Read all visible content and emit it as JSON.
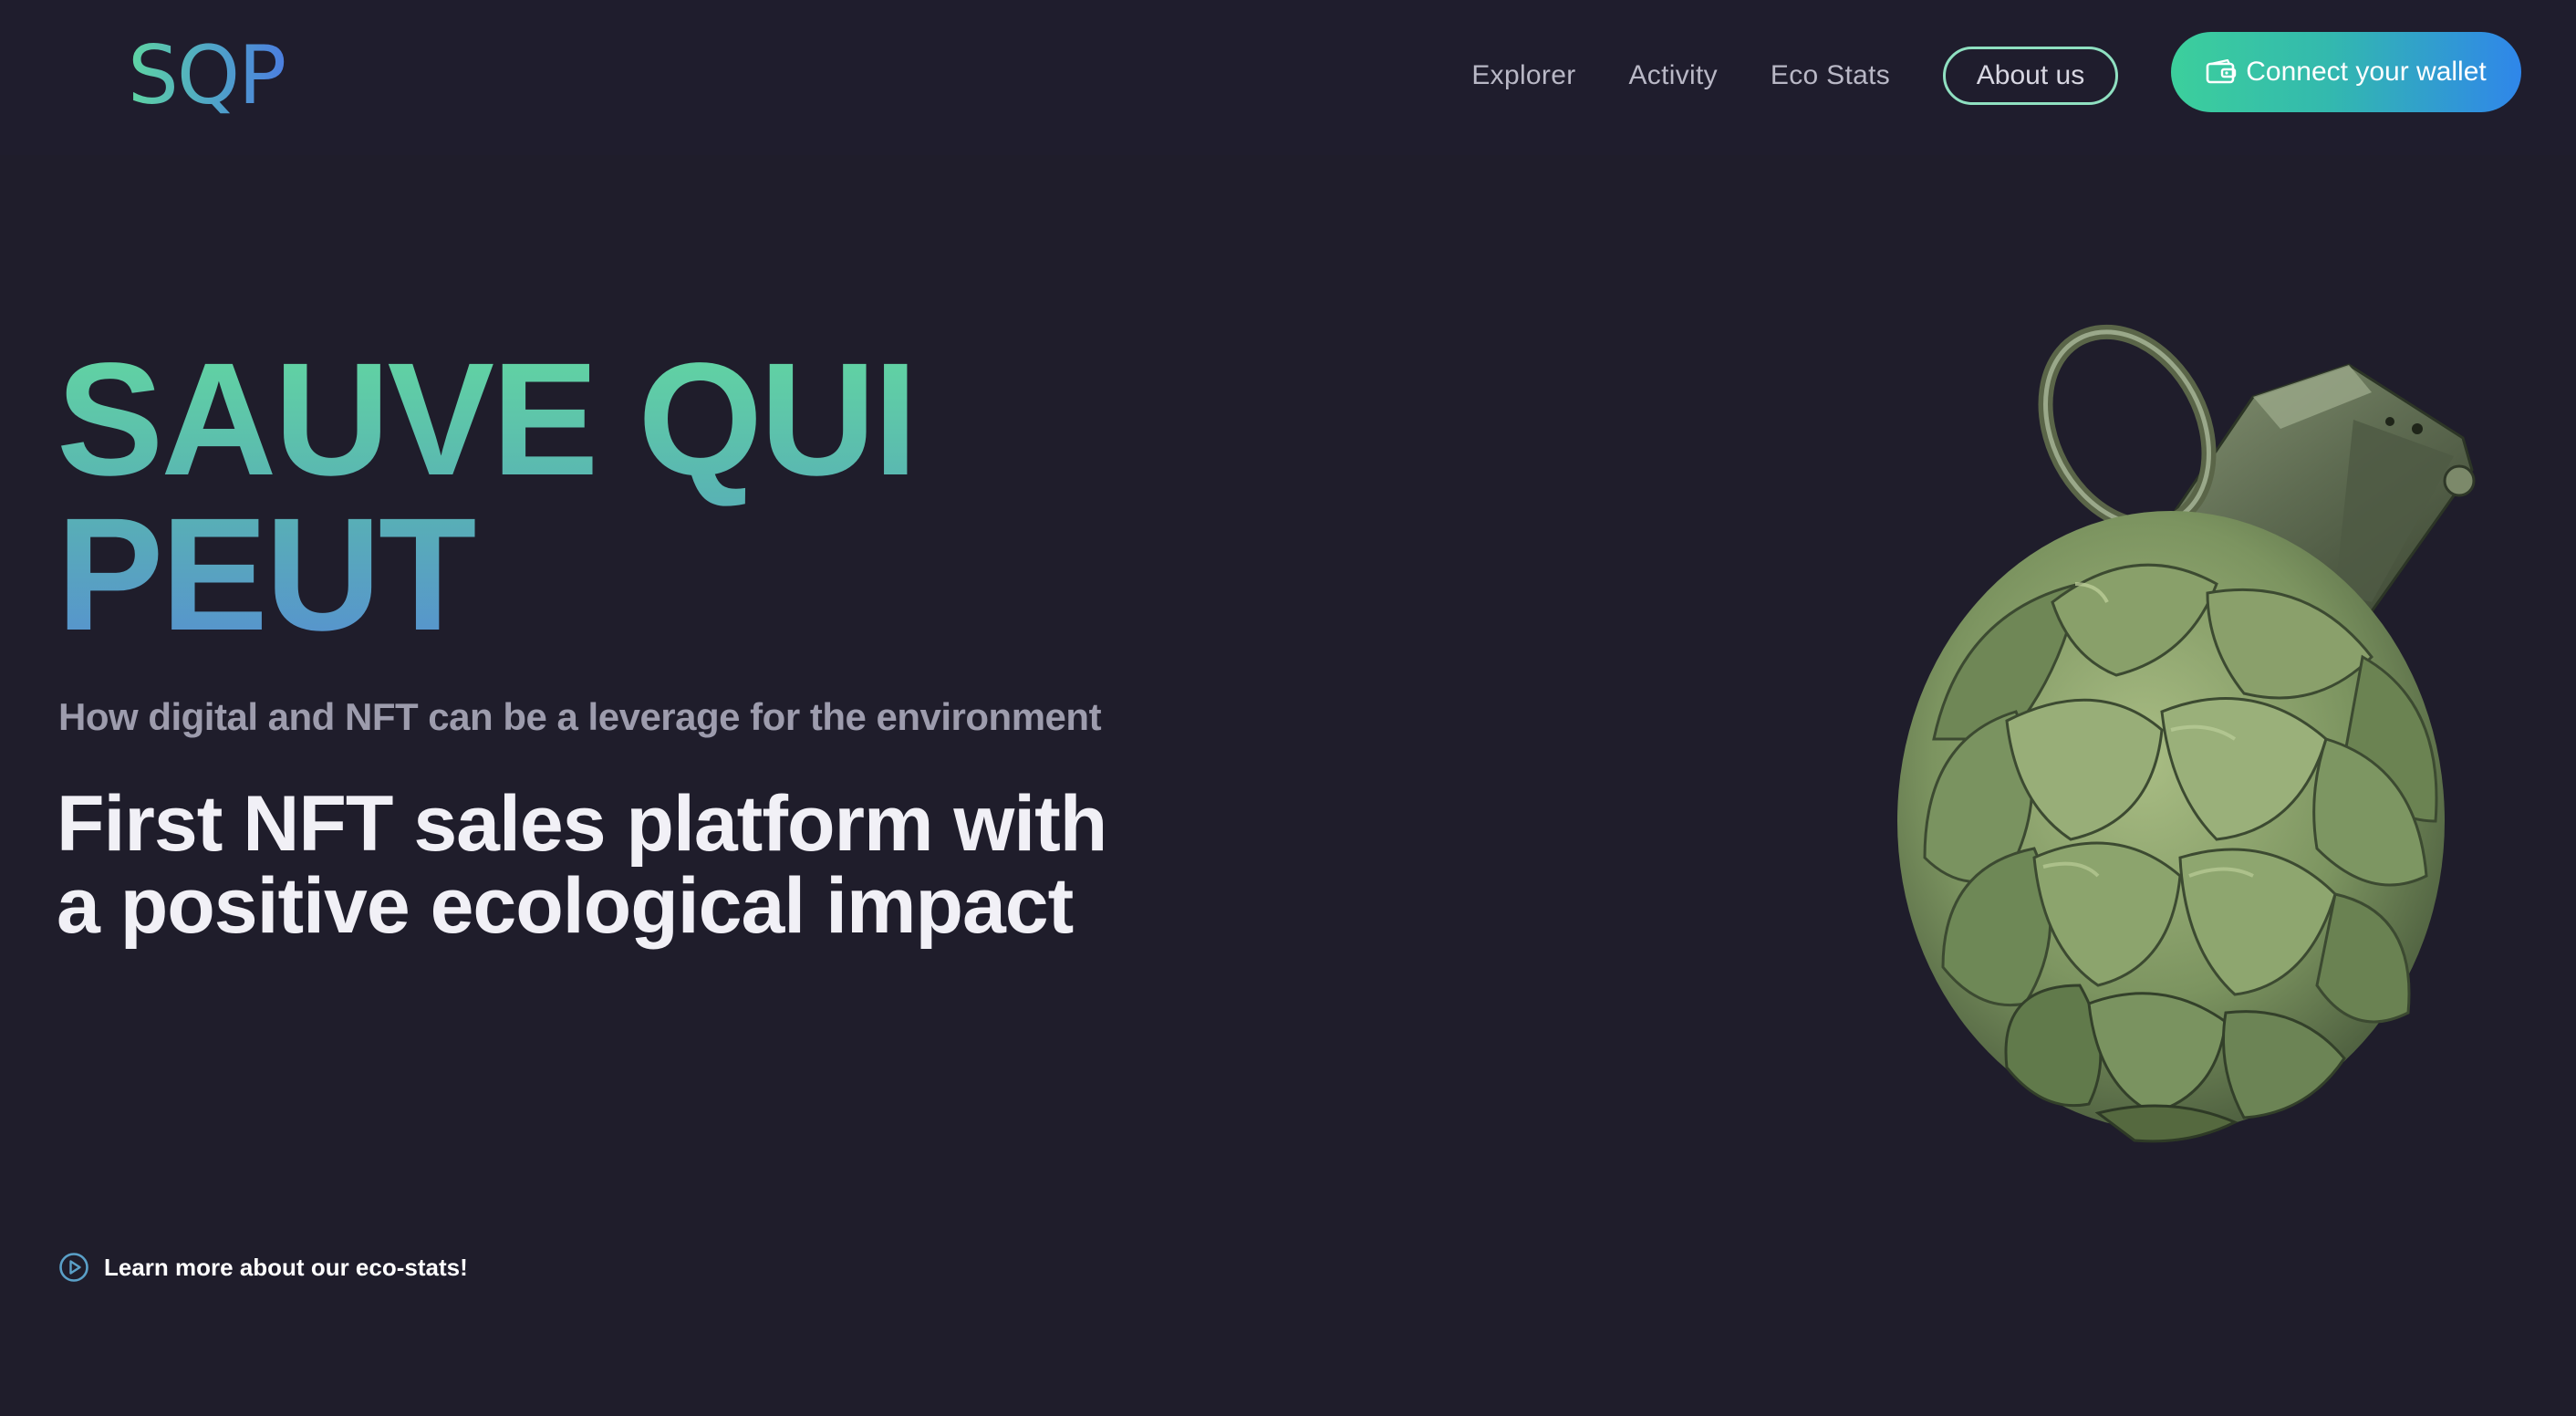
{
  "header": {
    "logo": "SQP",
    "nav": {
      "explorer": "Explorer",
      "activity": "Activity",
      "eco_stats": "Eco Stats",
      "about": "About us",
      "connect": "Connect your wallet"
    }
  },
  "hero": {
    "title_line1": "SAUVE QUI",
    "title_line2": "PEUT",
    "subtitle": "How digital and NFT can be a leverage for the environment",
    "tagline_line1": "First NFT sales platform with",
    "tagline_line2": "a positive ecological impact",
    "learn_more": "Learn more about our eco-stats!"
  },
  "image": {
    "subject": "artichoke-grenade"
  },
  "colors": {
    "background": "#1f1d2b",
    "accent_green": "#5fd6a2",
    "accent_blue": "#2f86ea",
    "text_primary": "#f1f0f6",
    "text_muted": "#9d9cad"
  },
  "icons": {
    "wallet": "wallet-icon",
    "play": "play-circle-icon"
  }
}
